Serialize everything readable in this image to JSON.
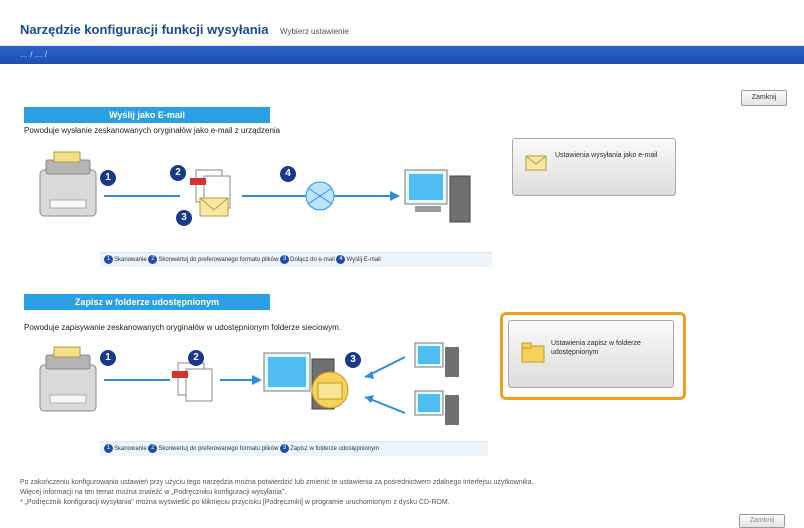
{
  "window": {
    "title": "Narzędzie konfiguracji funkcji wysyłania",
    "subtitle": "Wybierz ustawienie",
    "breadcrumb": "… / … /",
    "close_button": "Zamknij"
  },
  "email_section": {
    "header": "Wyślij jako E-mail",
    "description": "Powoduje wysłanie zeskanowanych oryginałów jako e-mail z urządzenia",
    "legend": [
      {
        "num": "1",
        "text": "Skanowanie"
      },
      {
        "num": "2",
        "text": "Skonwertuj do preferowanego formatu plików"
      },
      {
        "num": "3",
        "text": "Dołącz do e-mail"
      },
      {
        "num": "4",
        "text": "Wyślij E-mail"
      }
    ],
    "action_label": "Ustawienia wysyłania jako e-mail"
  },
  "folder_section": {
    "header": "Zapisz w folderze udostępnionym",
    "description": "Powoduje zapisywanie zeskanowanych oryginałów w udostępnionym folderze sieciowym.",
    "legend": [
      {
        "num": "1",
        "text": "Skanowanie"
      },
      {
        "num": "2",
        "text": "Skonwertuj do preferowanego formatu plików"
      },
      {
        "num": "3",
        "text": "Zapisz w folderze udostępnionym"
      }
    ],
    "action_label": "Ustawienia zapisz w folderze udostępnionym"
  },
  "footer": {
    "line1": "Po zakończeniu konfigurowania ustawień przy użyciu tego narzędzia można potwierdzić lub zmienić te ustawienia za pośrednictwem zdalnego interfejsu użytkownika.",
    "line2": "Więcej informacji na ten temat można znaleźć w „Podręczniku konfiguracji wysyłania\".",
    "line3": "* „Podręcznik konfiguracji wysyłania\" można wyświetlić po kliknięciu przycisku [Podręczniki] w programie uruchomionym z dysku CD-ROM."
  },
  "colors": {
    "accent": "#2aa0e4",
    "highlight": "#f0a020",
    "nav": "#1c4fae"
  }
}
